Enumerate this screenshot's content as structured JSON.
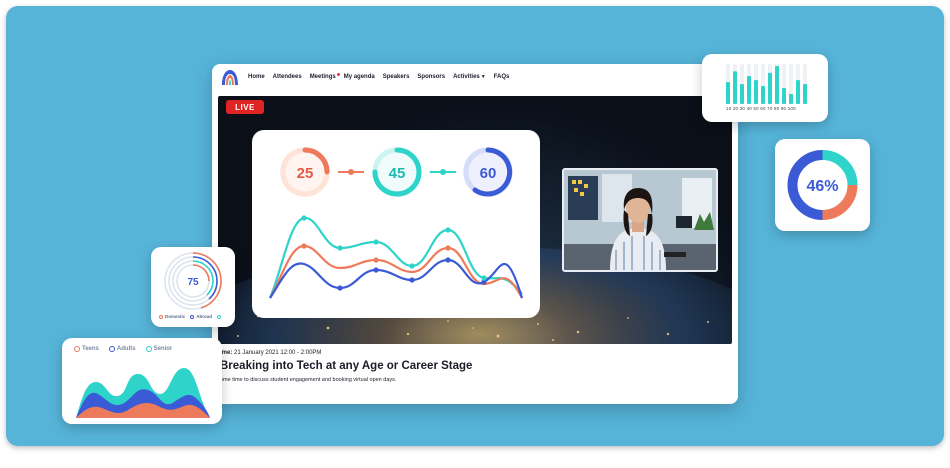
{
  "nav": {
    "items": [
      "Home",
      "Attendees",
      "Meetings",
      "My agenda",
      "Speakers",
      "Sponsors",
      "Activities",
      "FAQs"
    ]
  },
  "stage": {
    "live_label": "LIVE",
    "kpis": [
      "25",
      "45",
      "60"
    ]
  },
  "event": {
    "time_prefix": "ime:",
    "time_text": " 21 January 2021 12:00 - 2:00PM",
    "title": "Breaking into Tech at any Age or Career Stage",
    "description": "ome time to discuss student engagement and booking virtual open days."
  },
  "bars_card": {
    "axis_labels": "10 20 30 40 50 60 70 80 90 100",
    "values": [
      0.55,
      0.82,
      0.5,
      0.7,
      0.6,
      0.45,
      0.78,
      0.95,
      0.4,
      0.25,
      0.6,
      0.5
    ]
  },
  "pct_card": {
    "value_label": "46%",
    "value": 0.46
  },
  "ring_card": {
    "value_label": "75",
    "legend": [
      "Domestic",
      "Abroad",
      ""
    ]
  },
  "area_card": {
    "legend": [
      "Teens",
      "Adults",
      "Senior"
    ]
  },
  "colors": {
    "backdrop": "#56b4d9",
    "coral": "#ee7a5c",
    "teal": "#2ed3c9",
    "blue": "#3b5bd6",
    "live": "#e02424"
  }
}
